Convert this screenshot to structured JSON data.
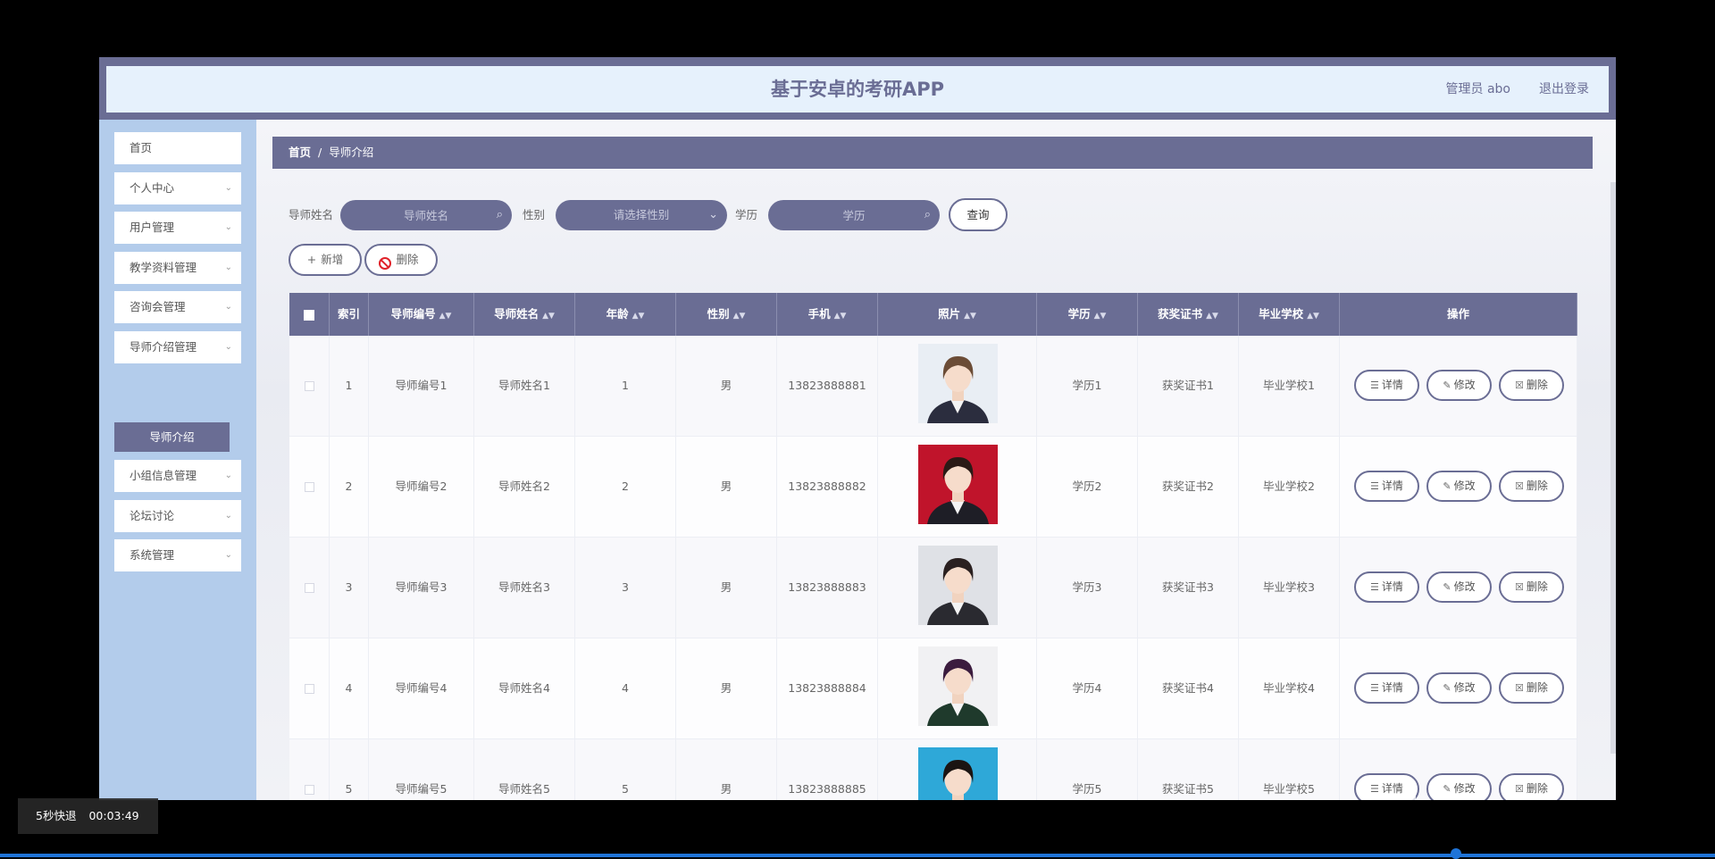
{
  "app": {
    "title": "基于安卓的考研APP",
    "user": "管理员 abo",
    "logout": "退出登录"
  },
  "sidebar": {
    "items": [
      {
        "label": "首页",
        "has_chevron": false
      },
      {
        "label": "个人中心",
        "has_chevron": true
      },
      {
        "label": "用户管理",
        "has_chevron": true
      },
      {
        "label": "教学资料管理",
        "has_chevron": true
      },
      {
        "label": "咨询会管理",
        "has_chevron": true
      },
      {
        "label": "导师介绍管理",
        "has_chevron": true
      },
      {
        "label": "小组信息管理",
        "has_chevron": true
      },
      {
        "label": "论坛讨论",
        "has_chevron": true
      },
      {
        "label": "系统管理",
        "has_chevron": true
      }
    ],
    "active_sub": "导师介绍"
  },
  "breadcrumb": {
    "home": "首页",
    "sep": "/",
    "current": "导师介绍"
  },
  "search": {
    "name_label": "导师姓名",
    "name_placeholder": "导师姓名",
    "gender_label": "性别",
    "gender_placeholder": "请选择性别",
    "edu_label": "学历",
    "edu_placeholder": "学历",
    "query": "查询"
  },
  "actions": {
    "add": "新增",
    "add_icon": "+",
    "delete": "删除"
  },
  "table": {
    "headers": [
      "索引",
      "导师编号",
      "导师姓名",
      "年龄",
      "性别",
      "手机",
      "照片",
      "学历",
      "获奖证书",
      "毕业学校",
      "操作"
    ],
    "sort_icon": "▲▼",
    "rows": [
      {
        "index": "1",
        "code": "导师编号1",
        "name": "导师姓名1",
        "age": "1",
        "gender": "男",
        "phone": "13823888881",
        "edu": "学历1",
        "cert": "获奖证书1",
        "school": "毕业学校1"
      },
      {
        "index": "2",
        "code": "导师编号2",
        "name": "导师姓名2",
        "age": "2",
        "gender": "男",
        "phone": "13823888882",
        "edu": "学历2",
        "cert": "获奖证书2",
        "school": "毕业学校2"
      },
      {
        "index": "3",
        "code": "导师编号3",
        "name": "导师姓名3",
        "age": "3",
        "gender": "男",
        "phone": "13823888883",
        "edu": "学历3",
        "cert": "获奖证书3",
        "school": "毕业学校3"
      },
      {
        "index": "4",
        "code": "导师编号4",
        "name": "导师姓名4",
        "age": "4",
        "gender": "男",
        "phone": "13823888884",
        "edu": "学历4",
        "cert": "获奖证书4",
        "school": "毕业学校4"
      },
      {
        "index": "5",
        "code": "导师编号5",
        "name": "导师姓名5",
        "age": "5",
        "gender": "男",
        "phone": "13823888885",
        "edu": "学历5",
        "cert": "获奖证书5",
        "school": "毕业学校5"
      }
    ],
    "op_buttons": {
      "detail": "详情",
      "edit": "修改",
      "delete": "删除"
    }
  },
  "photos": [
    {
      "bg": "#e9eef4",
      "hair": "#6b4c36",
      "suit": "#2b2d3e"
    },
    {
      "bg": "#c0142b",
      "hair": "#2a1a16",
      "suit": "#1e1e26"
    },
    {
      "bg": "#dfe1e6",
      "hair": "#2a2020",
      "suit": "#2a2a30"
    },
    {
      "bg": "#f1f1f3",
      "hair": "#3b1c3e",
      "suit": "#1f3a2c"
    },
    {
      "bg": "#2ea8d8",
      "hair": "#1b1412",
      "suit": "#2a2a30"
    }
  ],
  "video": {
    "skip": "5秒快退",
    "time": "00:03:49"
  },
  "colors": {
    "primary": "#6a6d94",
    "header_bg": "#e6f1fc",
    "sidebar_bg": "#b3cceb",
    "progress": "#1f74d8"
  }
}
